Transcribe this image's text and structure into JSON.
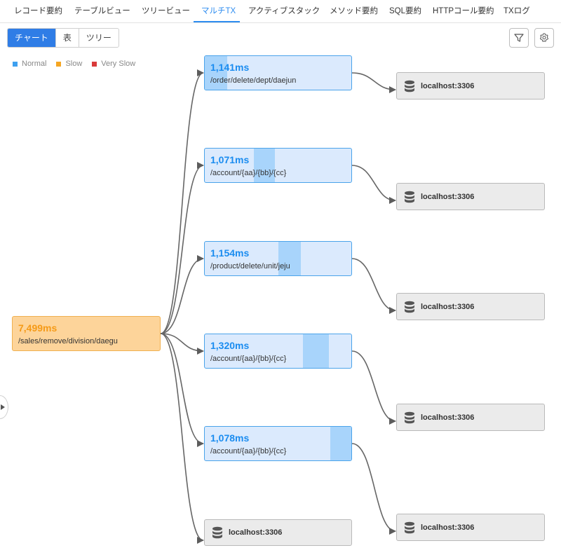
{
  "tabs": [
    {
      "label": "レコード要約"
    },
    {
      "label": "テーブルビュー"
    },
    {
      "label": "ツリービュー"
    },
    {
      "label": "マルチTX"
    },
    {
      "label": "アクティブスタック"
    },
    {
      "label": "メソッド要約"
    },
    {
      "label": "SQL要約"
    },
    {
      "label": "HTTPコール要約"
    },
    {
      "label": "TXログ"
    }
  ],
  "active_tab": "マルチTX",
  "view_toggle": {
    "chart": "チャート",
    "table": "表",
    "tree": "ツリー",
    "active": "チャート"
  },
  "toolbar": {
    "filter_icon": "filter-icon",
    "settings_icon": "gear-icon"
  },
  "legend": [
    {
      "label": "Normal",
      "color": "#3ea0f0"
    },
    {
      "label": "Slow",
      "color": "#f5a623"
    },
    {
      "label": "Very Slow",
      "color": "#d93a3a"
    }
  ],
  "root": {
    "time": "7,499ms",
    "path": "/sales/remove/division/daegu",
    "status": "Slow"
  },
  "transactions": [
    {
      "time": "1,141ms",
      "path": "/order/delete/dept/daejun",
      "db": "localhost:3306",
      "start_fraction": 0.0,
      "duration_fraction": 0.152
    },
    {
      "time": "1,071ms",
      "path": "/account/{aa}/{bb}/{cc}",
      "db": "localhost:3306",
      "start_fraction": 0.337,
      "duration_fraction": 0.143
    },
    {
      "time": "1,154ms",
      "path": "/product/delete/unit/jeju",
      "db": "localhost:3306",
      "start_fraction": 0.502,
      "duration_fraction": 0.154
    },
    {
      "time": "1,320ms",
      "path": "/account/{aa}/{bb}/{cc}",
      "db": "localhost:3306",
      "start_fraction": 0.672,
      "duration_fraction": 0.176
    },
    {
      "time": "1,078ms",
      "path": "/account/{aa}/{bb}/{cc}",
      "db": "localhost:3306",
      "start_fraction": 0.856,
      "duration_fraction": 0.144
    }
  ],
  "direct_db": "localhost:3306",
  "colors": {
    "accent": "#2d8cf0",
    "normal_fill": "#dbeafd",
    "slow_fill": "#fdd49a",
    "db_fill": "#ebebeb"
  }
}
